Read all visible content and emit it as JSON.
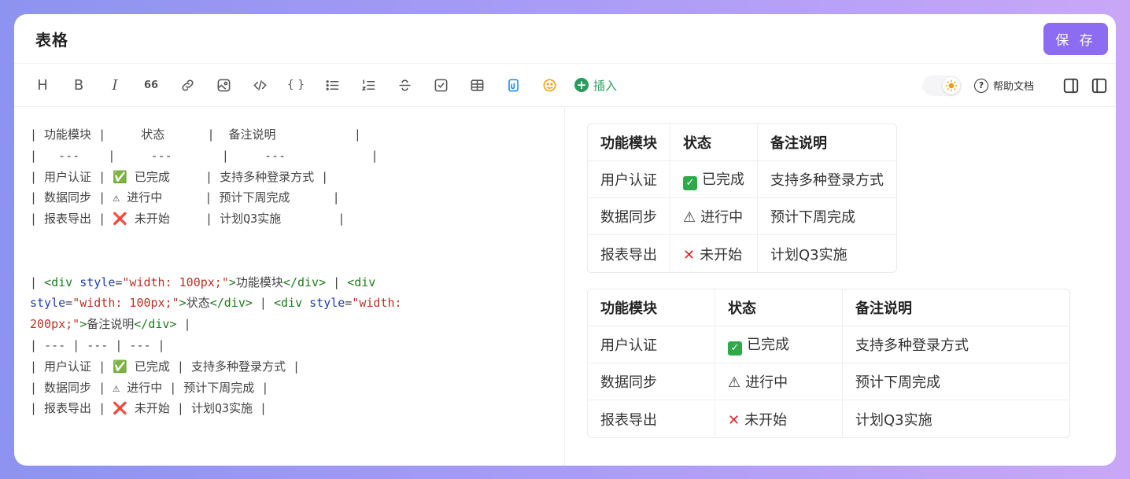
{
  "header": {
    "title": "表格",
    "save_label": "保 存"
  },
  "toolbar": {
    "heading_label": "H",
    "bold_label": "B",
    "italic_label": "I",
    "quote_label": "66",
    "code_label": "{ }",
    "insert_label": "插入",
    "help_label": "帮助文档"
  },
  "editor": {
    "md_table": [
      "| 功能模块 |     状态      |  备注说明           |",
      "|   ---    |     ---       |     ---            |",
      "| 用户认证 | ✅ 已完成     | 支持多种登录方式 |",
      "| 数据同步 | ⚠ 进行中      | 预计下周完成      |",
      "| 报表导出 | ❌ 未开始     | 计划Q3实施        |"
    ],
    "html_line1_a": "| ",
    "html_tag_open": "<div ",
    "html_attr": "style",
    "html_eq": "=",
    "html_val1": "\"width: 100px;\"",
    "html_close1": ">",
    "html_text1": "功能模块",
    "html_tag_close": "</div>",
    "html_sep": " | ",
    "html_val3a": "\"width:",
    "html_val3b": "200px;\"",
    "html_text2": "状态",
    "html_text3": "备注说明",
    "html_end": " |",
    "md_table2": [
      "| --- | --- | --- |",
      "| 用户认证 | ✅ 已完成 | 支持多种登录方式 |",
      "| 数据同步 | ⚠ 进行中 | 预计下周完成 |",
      "| 报表导出 | ❌ 未开始 | 计划Q3实施 |"
    ]
  },
  "preview": {
    "headers": [
      "功能模块",
      "状态",
      "备注说明"
    ],
    "rows": [
      {
        "module": "用户认证",
        "status": "已完成",
        "status_icon": "check-icon",
        "note": "支持多种登录方式"
      },
      {
        "module": "数据同步",
        "status": "进行中",
        "status_icon": "warning-icon",
        "note": "预计下周完成"
      },
      {
        "module": "报表导出",
        "status": "未开始",
        "status_icon": "cross-icon",
        "note": "计划Q3实施"
      }
    ]
  },
  "colors": {
    "accent": "#8b6cf2",
    "insert": "#2a9d5c",
    "tag": "#1f7a1f",
    "attr": "#1f3fa8",
    "string": "#b83227"
  }
}
